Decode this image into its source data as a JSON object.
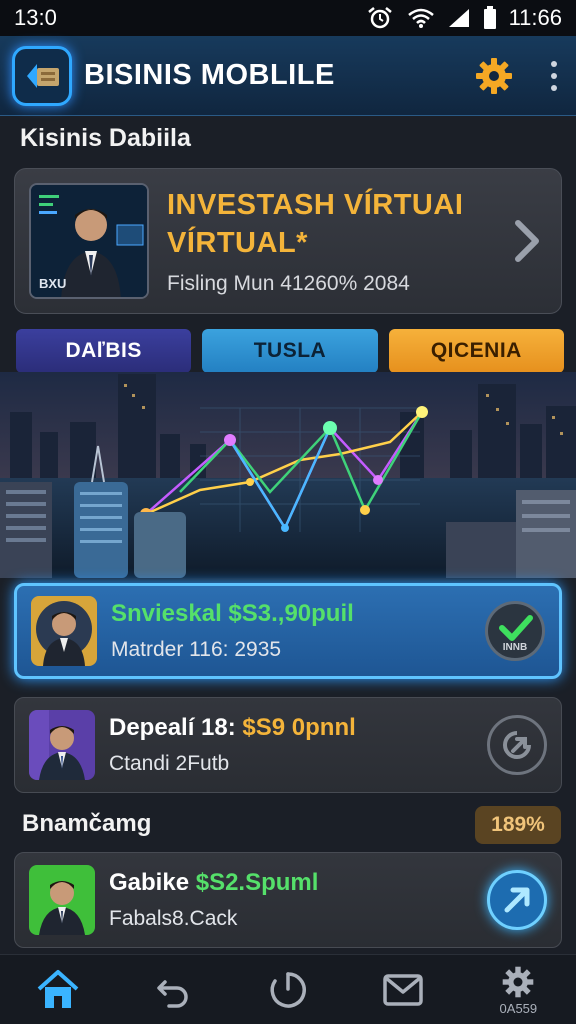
{
  "status_bar": {
    "time_left": "13:0",
    "time_right": "11:66"
  },
  "app_bar": {
    "title": "BISINIS MOBLILE"
  },
  "section": {
    "title": "Kisinis Dabiila"
  },
  "feature": {
    "title_line1": "INVESTASH VÍRTUAI",
    "title_line2": "VÍRTUAL*",
    "subtitle": "Fisling Mun 41260% 2084",
    "thumb_badge": "BXU"
  },
  "tabs": [
    {
      "label": "DAľBIS"
    },
    {
      "label": "TUSLA"
    },
    {
      "label": "QICENIA"
    }
  ],
  "transactions": [
    {
      "title": "Snvieskal $S3.,90puil",
      "subtitle": "Matrder 116: 2935",
      "action_label": "INNB"
    },
    {
      "title_prefix": "Depealí 18: ",
      "title_amount": "$S9 0pnnl",
      "subtitle": "Ctandi 2Futb"
    }
  ],
  "section2": {
    "title": "Bnamčamg",
    "badge": "189%"
  },
  "last_item": {
    "title_prefix": "Gabike ",
    "title_amount": "$S2.Spuml",
    "subtitle": "Fabals8.Cack"
  },
  "bottom_nav": [
    {
      "icon": "home-icon"
    },
    {
      "icon": "undo-icon"
    },
    {
      "icon": "refresh-icon"
    },
    {
      "icon": "mail-icon"
    },
    {
      "icon": "gear-icon",
      "label": "0A559"
    }
  ],
  "colors": {
    "accent_blue": "#2fa8ff",
    "gold": "#f4b43a",
    "green": "#55e06a",
    "orange": "#f6b13b"
  }
}
